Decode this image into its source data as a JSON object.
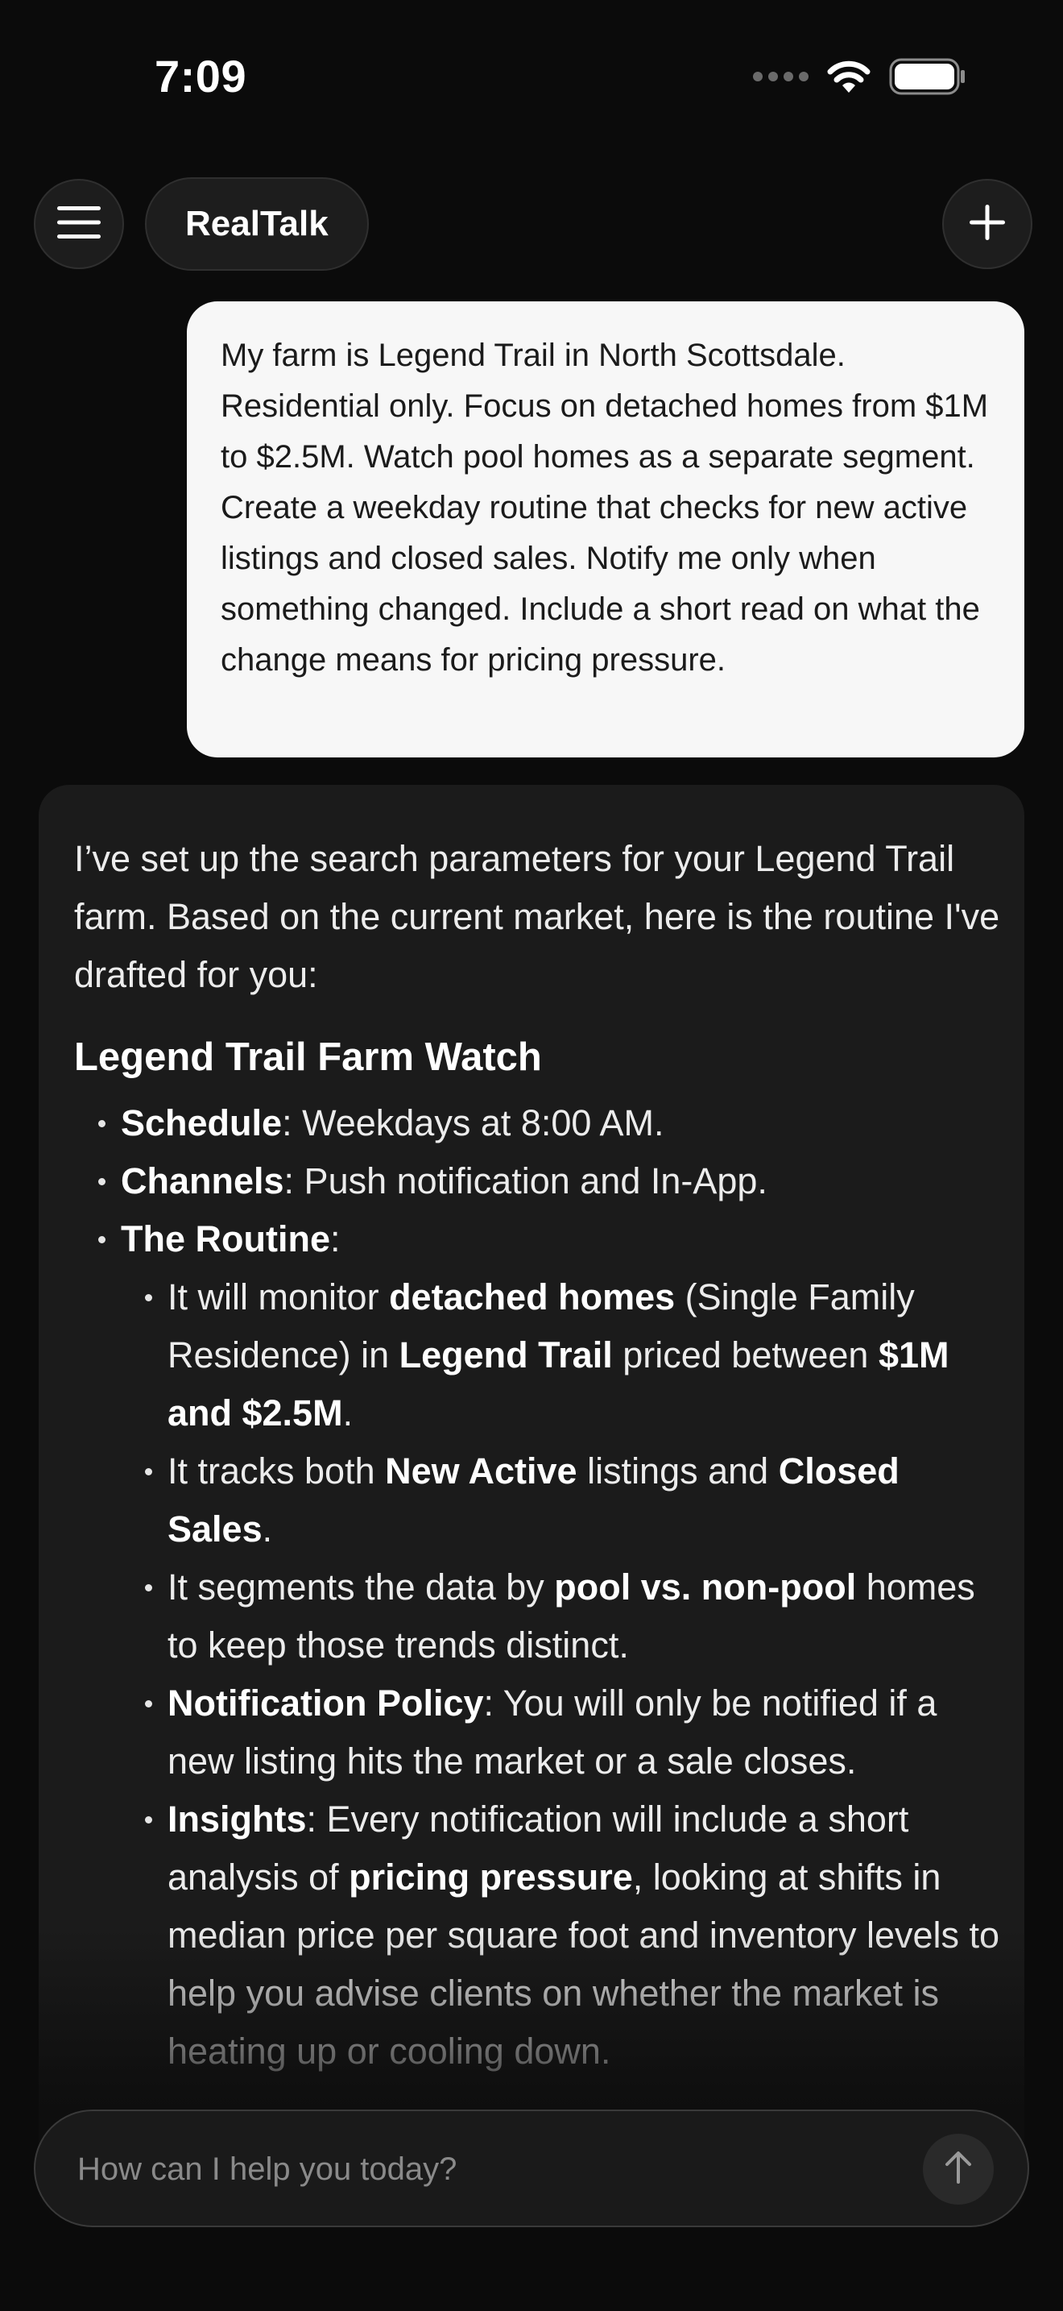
{
  "status_bar": {
    "time": "7:09"
  },
  "header": {
    "title": "RealTalk",
    "menu_icon": "hamburger-icon",
    "new_chat_icon": "plus-icon"
  },
  "user_message": {
    "text": "My farm is Legend Trail in North Scottsdale. Residential only. Focus on detached homes from $1M to $2.5M. Watch pool homes as a separate segment. Create a weekday routine that checks for new active listings and closed sales. Notify me only when something changed. Include a short read on what the change means for pricing pressure."
  },
  "assistant_message": {
    "intro": "I’ve set up the search parameters for your Legend Trail farm. Based on the current market, here is the routine I've drafted for you:",
    "heading": "Legend Trail Farm Watch",
    "schedule": {
      "label": "Schedule",
      "text": ": Weekdays at 8:00 AM."
    },
    "channels": {
      "label": "Channels",
      "text": ": Push notification and In-App."
    },
    "routine": {
      "label": "The Routine",
      "suffix": ":",
      "item1": {
        "t1": "It will monitor ",
        "b1": "detached homes",
        "t2": " (Single Family Residence) in ",
        "b2": "Legend Trail",
        "t3": " priced between ",
        "b3": "$1M and $2.5M",
        "t4": "."
      },
      "item2": {
        "t1": "It tracks both ",
        "b1": "New Active",
        "t2": " listings and ",
        "b2": "Closed Sales",
        "t3": "."
      },
      "item3": {
        "t1": "It segments the data by ",
        "b1": "pool vs. non-pool",
        "t2": " homes to keep those trends distinct."
      },
      "item4": {
        "b1": "Notification Policy",
        "t1": ": You will only be notified if a new listing hits the market or a sale closes."
      },
      "item5": {
        "b1": "Insights",
        "t1": ": Every notification will include a short analysis of ",
        "b2": "pricing pressure",
        "t2": ", looking at shifts in median price per square foot and inventory levels to help you advise clients on whether the market is heating up or cooling down."
      }
    }
  },
  "composer": {
    "placeholder": "How can I help you today?",
    "send_icon": "arrow-up-icon"
  }
}
